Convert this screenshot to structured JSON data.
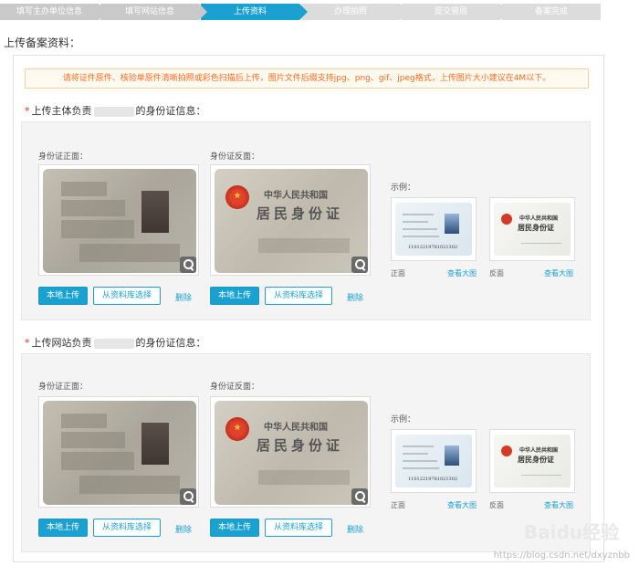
{
  "steps": [
    {
      "label": "填写主办单位信息",
      "state": "done"
    },
    {
      "label": "填写网站信息",
      "state": "done"
    },
    {
      "label": "上传资料",
      "state": "active"
    },
    {
      "label": "办理拍照",
      "state": "todo"
    },
    {
      "label": "提交管局",
      "state": "todo"
    },
    {
      "label": "备案完成",
      "state": "todo"
    }
  ],
  "page_title": "上传备案资料：",
  "notice": "请将证件原件、核验单原件清晰拍照或彩色扫描后上传，图片文件后缀支持jpg、png、gif、jpeg格式，上传图片大小建议在4M以下。",
  "sections": [
    {
      "title_prefix": "上传主体负责",
      "title_suffix": "的身份证信息：",
      "front_label": "身份证正面：",
      "back_label": "身份证反面：",
      "back_card_line1": "中华人民共和国",
      "back_card_line2": "居民身份证"
    },
    {
      "title_prefix": "上传网站负责",
      "title_suffix": "的身份证信息：",
      "front_label": "身份证正面：",
      "back_label": "身份证反面：",
      "back_card_line1": "中华人民共和国",
      "back_card_line2": "居民身份证"
    }
  ],
  "buttons": {
    "local_upload": "本地上传",
    "from_library": "从资料库选择",
    "delete": "删除"
  },
  "example": {
    "label": "示例：",
    "front_caption": "正面",
    "back_caption": "反面",
    "view_large": "查看大图",
    "front_id_number": "11012219781021302",
    "back_line1": "中华人民共和国",
    "back_line2": "居民身份证"
  },
  "watermark": {
    "brand": "Baidu经验",
    "url": "https://blog.csdn.net/dxyznbb"
  },
  "colors": {
    "accent": "#1aa1d0",
    "notice_text": "#ff6a1f",
    "required_star": "#ee2233"
  }
}
